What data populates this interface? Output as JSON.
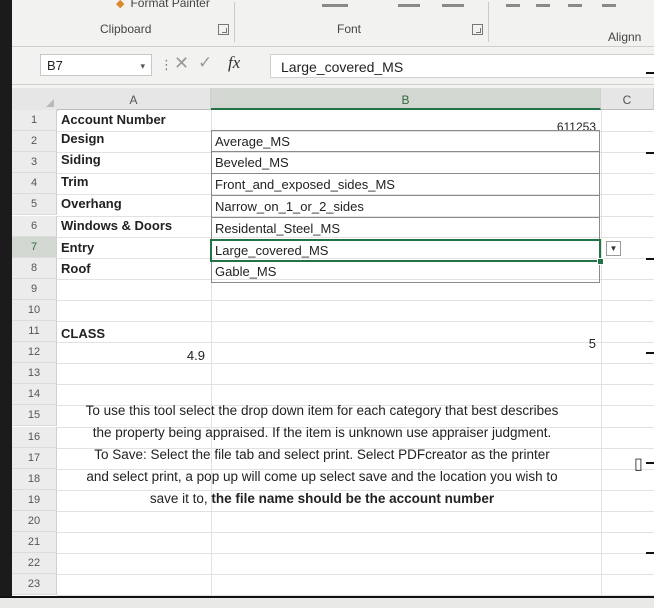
{
  "ribbon": {
    "format_painter": "Format Painter",
    "groups": {
      "clipboard": "Clipboard",
      "font": "Font",
      "alignment": "Alignn"
    }
  },
  "formula_bar": {
    "name_box": "B7",
    "formula": "Large_covered_MS"
  },
  "columns": [
    "A",
    "B",
    "C"
  ],
  "rows": [
    "1",
    "2",
    "3",
    "4",
    "5",
    "6",
    "7",
    "8",
    "9",
    "10",
    "11",
    "12",
    "13",
    "14",
    "15",
    "16",
    "17",
    "18",
    "19",
    "20",
    "21",
    "22",
    "23"
  ],
  "cells": {
    "A1": "Account Number",
    "B1": "611253",
    "A2": "Design",
    "B2": "Average_MS",
    "A3": "Siding",
    "B3": "Beveled_MS",
    "A4": "Trim",
    "B4": "Front_and_exposed_sides_MS",
    "A5": "Overhang",
    "B5": "Narrow_on_1_or_2_sides",
    "A6": "Windows & Doors",
    "B6": "Residental_Steel_MS",
    "A7": "Entry",
    "B7": "Large_covered_MS",
    "A8": "Roof",
    "B8": "Gable_MS",
    "A11": "CLASS",
    "A12": "4.9",
    "B11": "5"
  },
  "instructions": {
    "text": "To use this tool select the drop down item for each category that best describes\nthe property being appraised.  If the item is unknown use appraiser judgment.\nTo Save: Select the file tab and select print.  Select PDFcreator as the printer\nand select print, a pop up will come up select save and the location you wish to\nsave it to, ",
    "bold_text": "the file name should be the account number"
  },
  "colors": {
    "accent": "#217346"
  }
}
